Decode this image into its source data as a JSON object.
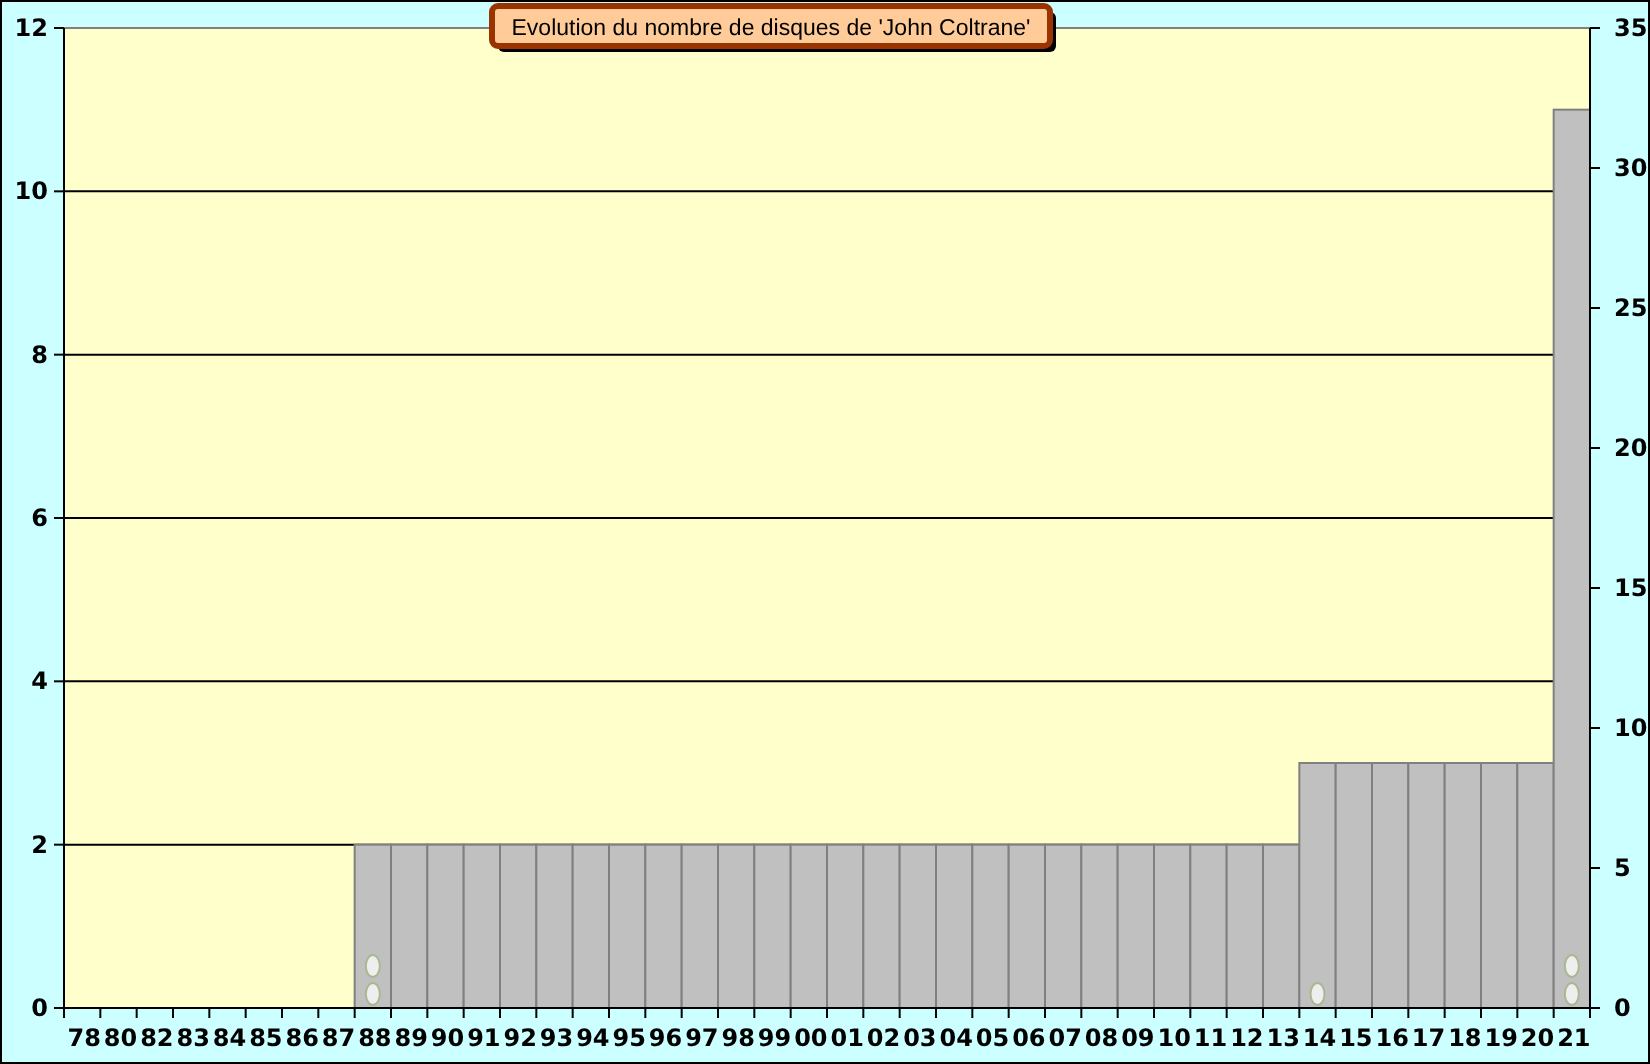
{
  "chart": {
    "secondary_axis_ticks": [
      "35",
      "30",
      "25",
      "20",
      "15",
      "10",
      "5",
      "0"
    ],
    "chart_data": {
      "type": "bar",
      "title": "Evolution du nombre de disques de 'John Coltrane'",
      "categories": [
        "78",
        "80",
        "82",
        "83",
        "84",
        "85",
        "86",
        "87",
        "88",
        "89",
        "90",
        "91",
        "92",
        "93",
        "94",
        "95",
        "96",
        "97",
        "98",
        "99",
        "00",
        "01",
        "02",
        "03",
        "04",
        "05",
        "06",
        "07",
        "08",
        "09",
        "10",
        "11",
        "12",
        "13",
        "14",
        "15",
        "16",
        "17",
        "18",
        "19",
        "20",
        "21"
      ],
      "grid": true,
      "series": [
        {
          "color": "#c0c0c0",
          "values": [
            0,
            0,
            0,
            0,
            0,
            0,
            0,
            0,
            2,
            2,
            2,
            2,
            2,
            2,
            2,
            2,
            2,
            2,
            2,
            2,
            2,
            2,
            2,
            2,
            2,
            2,
            2,
            2,
            2,
            2,
            2,
            2,
            2,
            2,
            3,
            3,
            3,
            3,
            3,
            3,
            3,
            11
          ]
        }
      ],
      "ylim": [
        0,
        12
      ],
      "yticks": [
        0,
        2,
        4,
        6,
        8,
        10,
        12
      ]
    }
  }
}
